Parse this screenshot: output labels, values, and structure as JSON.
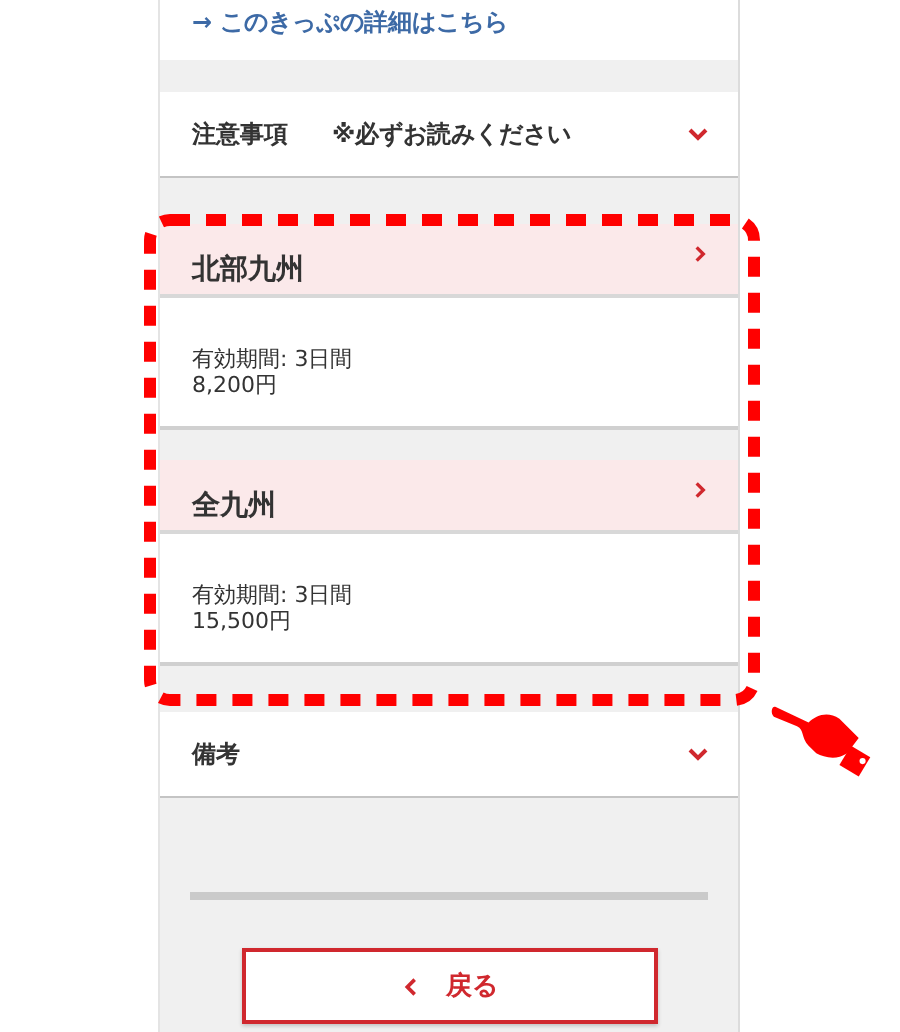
{
  "detail_link": "→ このきっぷの詳細はこちら",
  "sections": [
    {
      "kind": "accordion",
      "title": "注意事項",
      "note": "※必ずお読みください"
    },
    {
      "kind": "ticket",
      "name": "北部九州",
      "validity": "有効期間: 3日間",
      "price": "8,200円"
    },
    {
      "kind": "ticket",
      "name": "全九州",
      "validity": "有効期間: 3日間",
      "price": "15,500円"
    },
    {
      "kind": "accordion",
      "title": "備考"
    }
  ],
  "back_button": "戻る"
}
